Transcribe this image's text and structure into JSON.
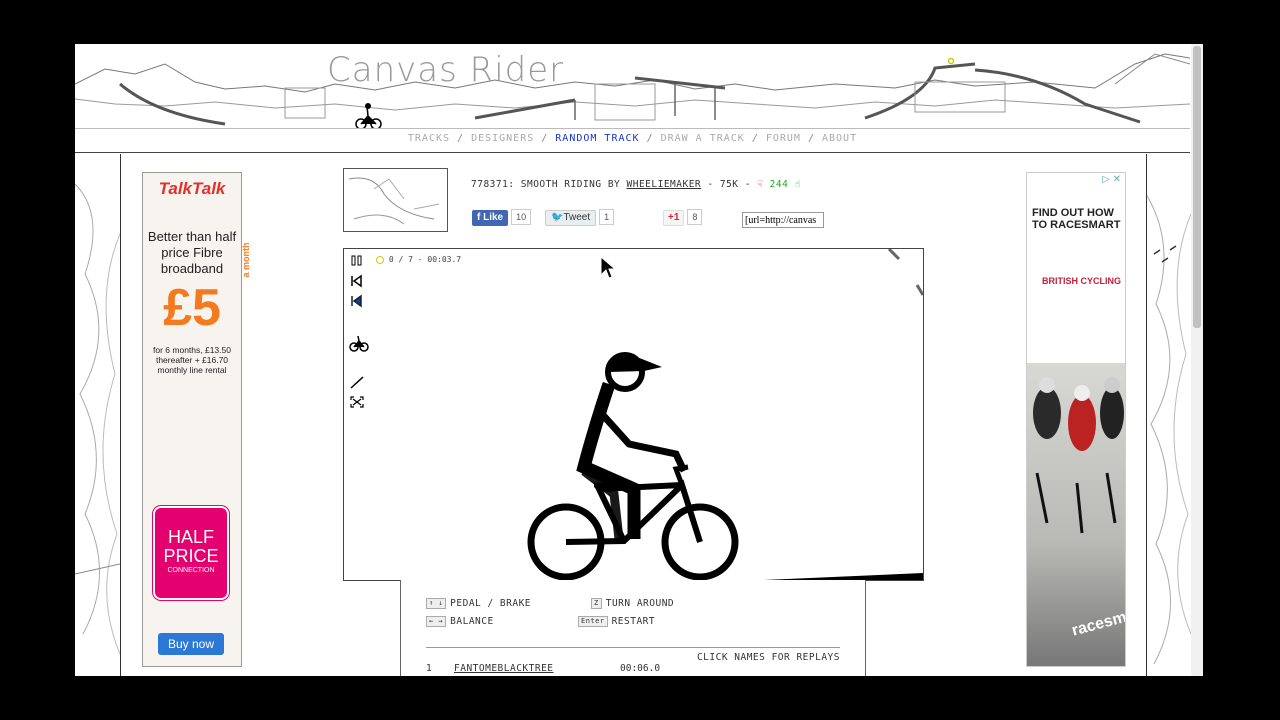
{
  "site": {
    "logo": "Canvas Rider"
  },
  "nav": {
    "items": [
      {
        "label": "TRACKS",
        "active": false
      },
      {
        "label": "DESIGNERS",
        "active": false
      },
      {
        "label": "RANDOM TRACK",
        "active": true
      },
      {
        "label": "DRAW A TRACK",
        "active": false
      },
      {
        "label": "FORUM",
        "active": false
      },
      {
        "label": "ABOUT",
        "active": false
      }
    ],
    "separator": "/"
  },
  "track": {
    "id_title": "778371: SMOOTH RIDING BY",
    "author": "WHEELIEMAKER",
    "size": "- 75K -",
    "votes": "244",
    "embed_value": "[url=http://canvas"
  },
  "social": {
    "facebook": {
      "label": "Like",
      "count": "10"
    },
    "twitter": {
      "label": "Tweet",
      "count": "1"
    },
    "gplus": {
      "label": "+1",
      "count": "8"
    }
  },
  "game": {
    "targets": "0 / 7",
    "dash": "-",
    "time": "00:03.7"
  },
  "controls": {
    "pedal_brake": "PEDAL / BRAKE",
    "balance": "BALANCE",
    "turn_around": "TURN AROUND",
    "restart": "RESTART",
    "key_z": "Z",
    "key_enter": "Enter",
    "key_updown": "↑ ↓",
    "key_leftright": "← →",
    "replays_hint": "CLICK NAMES FOR REPLAYS"
  },
  "leaderboard": [
    {
      "rank": "1",
      "name": "FANTOMEBLACKTREE",
      "time": "00:06.0"
    }
  ],
  "ad_left": {
    "brand": "TalkTalk",
    "headline": "Better than half price Fibre broadband",
    "price": "£5",
    "price_suffix": "a month",
    "fine_print": "for 6 months, £13.50 thereafter + £16.70 monthly line rental",
    "badge_line1": "HALF",
    "badge_line2": "PRICE",
    "badge_line3": "CONNECTION",
    "cta": "Buy now"
  },
  "ad_right": {
    "headline": "FIND OUT HOW TO RACESMART",
    "partner": "BRITISH CYCLING",
    "brand": "racesmart"
  },
  "colors": {
    "nav_active": "#1a33cc",
    "votes": "#22aa22",
    "fb": "#4267b2",
    "talktalk_red": "#e5302a",
    "orange": "#f47a20",
    "pink": "#e4006e"
  }
}
